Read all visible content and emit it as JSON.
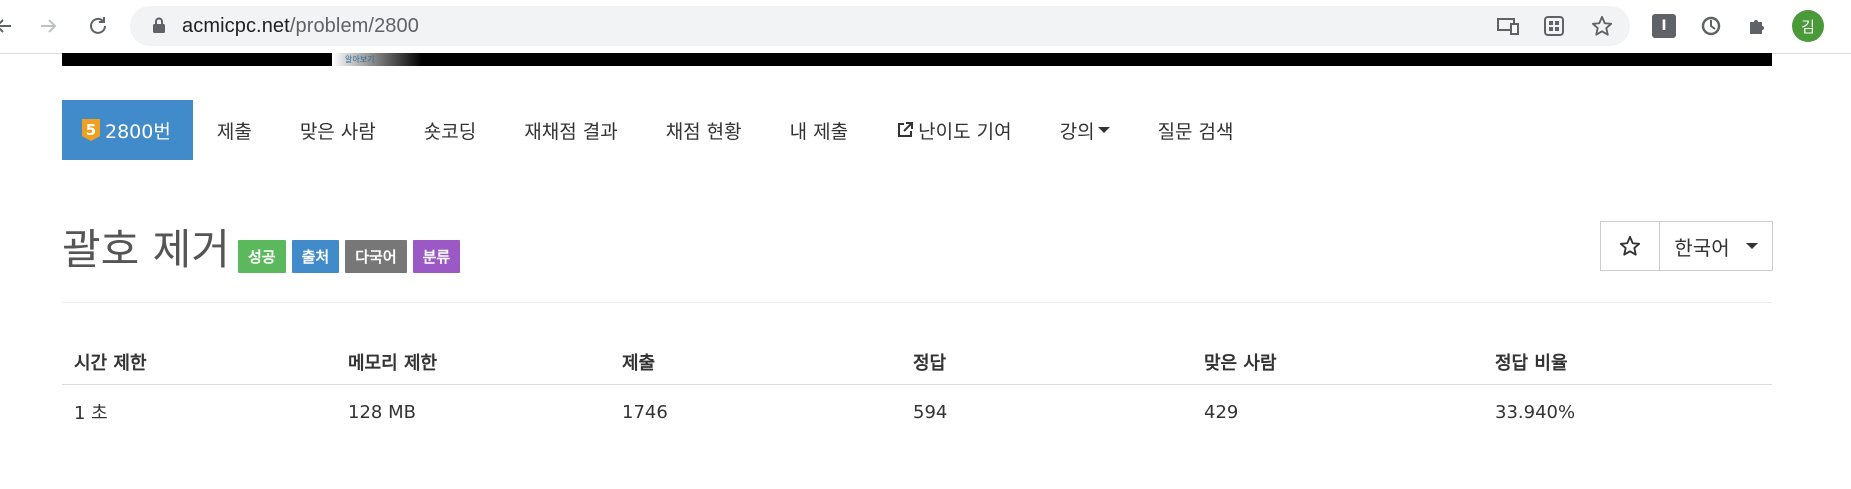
{
  "browser": {
    "url_domain": "acmicpc.net",
    "url_path": "/problem/2800",
    "avatar_initial": "김"
  },
  "banner": {
    "text": "알아보기"
  },
  "menu": {
    "tier_badge": "5",
    "items": [
      {
        "label": "2800번"
      },
      {
        "label": "제출"
      },
      {
        "label": "맞은 사람"
      },
      {
        "label": "숏코딩"
      },
      {
        "label": "재채점 결과"
      },
      {
        "label": "채점 현황"
      },
      {
        "label": "내 제출"
      },
      {
        "label": "난이도 기여"
      },
      {
        "label": "강의"
      },
      {
        "label": "질문 검색"
      }
    ]
  },
  "problem": {
    "title": "괄호 제거",
    "labels": [
      {
        "text": "성공",
        "color": "#5cb85c"
      },
      {
        "text": "출처",
        "color": "#428bca"
      },
      {
        "text": "다국어",
        "color": "#777777"
      },
      {
        "text": "분류",
        "color": "#9b59c6"
      }
    ],
    "language": "한국어"
  },
  "info_table": {
    "headers": [
      "시간 제한",
      "메모리 제한",
      "제출",
      "정답",
      "맞은 사람",
      "정답 비율"
    ],
    "row": [
      "1 초",
      "128 MB",
      "1746",
      "594",
      "429",
      "33.940%"
    ]
  }
}
